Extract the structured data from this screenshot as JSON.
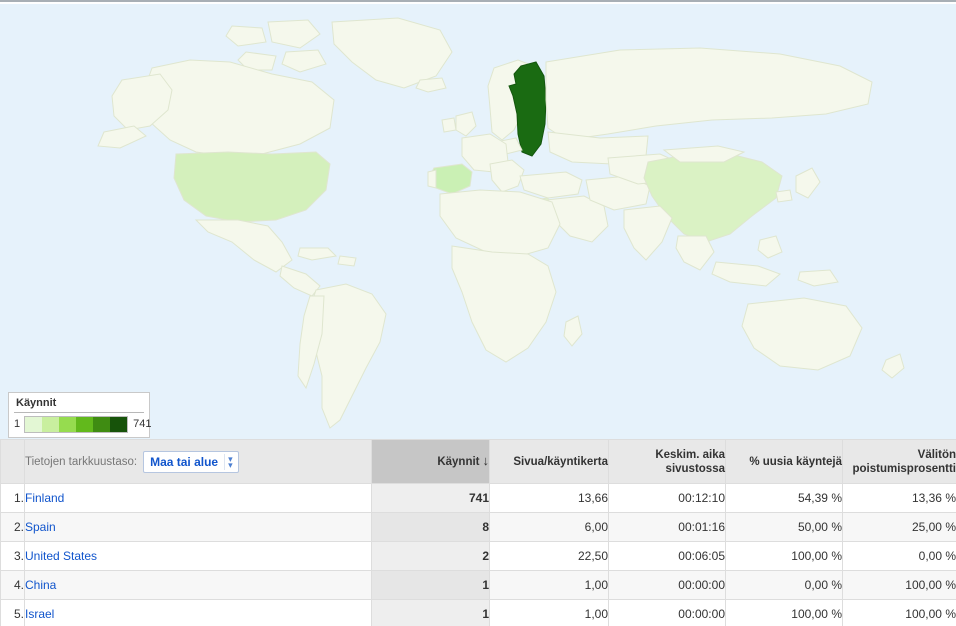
{
  "map": {
    "ocean_color": "#e6f2fb",
    "default_country_color": "#f5f8ec",
    "country_border_color": "#dfe6cf",
    "highlight_colors": {
      "finland": "#1a6b12",
      "spain": "#caf0b4",
      "united_states": "#d4f0bc",
      "china": "#daf2c4",
      "israel": "#dff3cc"
    }
  },
  "legend": {
    "title": "Käynnit",
    "min": "1",
    "max": "741",
    "swatches": [
      "#e3f7d4",
      "#c9ef9f",
      "#96dc4f",
      "#62b91c",
      "#3f8c12",
      "#17530a"
    ]
  },
  "table": {
    "dimension_control": {
      "label": "Tietojen tarkkuustaso:",
      "selected": "Maa tai alue",
      "chevron_icon": "chevron-double-down-icon"
    },
    "columns": [
      {
        "key": "index",
        "label": ""
      },
      {
        "key": "dimension",
        "label": ""
      },
      {
        "key": "visits",
        "label": "Käynnit",
        "sorted": true,
        "sort_direction": "desc",
        "sort_icon": "↓"
      },
      {
        "key": "pages_per_visit",
        "label": "Sivua/käyntikerta"
      },
      {
        "key": "avg_time",
        "label": "Keskim. aika sivustossa"
      },
      {
        "key": "new_visits_pct",
        "label": "% uusia käyntejä"
      },
      {
        "key": "bounce_rate",
        "label": "Välitön poistumisprosentti"
      }
    ],
    "rows": [
      {
        "index": "1.",
        "country": "Finland",
        "visits": "741",
        "pages_per_visit": "13,66",
        "avg_time": "00:12:10",
        "new_visits_pct": "54,39 %",
        "bounce_rate": "13,36 %"
      },
      {
        "index": "2.",
        "country": "Spain",
        "visits": "8",
        "pages_per_visit": "6,00",
        "avg_time": "00:01:16",
        "new_visits_pct": "50,00 %",
        "bounce_rate": "25,00 %"
      },
      {
        "index": "3.",
        "country": "United States",
        "visits": "2",
        "pages_per_visit": "22,50",
        "avg_time": "00:06:05",
        "new_visits_pct": "100,00 %",
        "bounce_rate": "0,00 %"
      },
      {
        "index": "4.",
        "country": "China",
        "visits": "1",
        "pages_per_visit": "1,00",
        "avg_time": "00:00:00",
        "new_visits_pct": "0,00 %",
        "bounce_rate": "100,00 %"
      },
      {
        "index": "5.",
        "country": "Israel",
        "visits": "1",
        "pages_per_visit": "1,00",
        "avg_time": "00:00:00",
        "new_visits_pct": "100,00 %",
        "bounce_rate": "100,00 %"
      }
    ]
  },
  "chart_data": {
    "type": "map",
    "title": "Käynnit",
    "metric": "Käynnit",
    "scale_min": 1,
    "scale_max": 741,
    "regions": [
      {
        "name": "Finland",
        "value": 741
      },
      {
        "name": "Spain",
        "value": 8
      },
      {
        "name": "United States",
        "value": 2
      },
      {
        "name": "China",
        "value": 1
      },
      {
        "name": "Israel",
        "value": 1
      }
    ]
  }
}
